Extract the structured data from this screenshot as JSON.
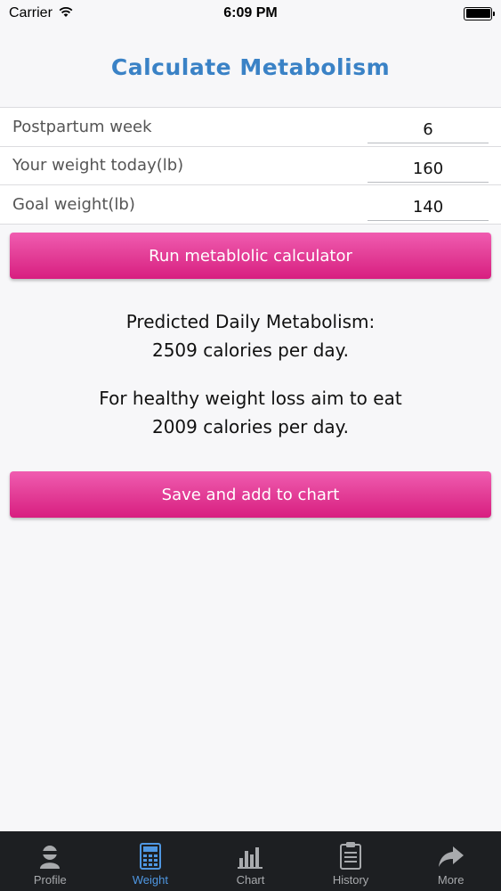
{
  "status_bar": {
    "carrier": "Carrier",
    "time": "6:09 PM",
    "icons": [
      "wifi-icon",
      "battery-icon"
    ]
  },
  "header": {
    "title": "Calculate Metabolism",
    "title_color": "#3a82c6"
  },
  "form": {
    "rows": [
      {
        "label": "Postpartum week",
        "value": "6"
      },
      {
        "label": "Your weight today(lb)",
        "value": "160"
      },
      {
        "label": "Goal weight(lb)",
        "value": "140"
      }
    ]
  },
  "actions": {
    "run_label": "Run metablolic calculator",
    "save_label": "Save and add to chart",
    "button_color": "#e33e97"
  },
  "results": {
    "metabolism_heading": "Predicted Daily Metabolism:",
    "metabolism_value": "2509 calories per day.",
    "loss_heading": "For healthy weight loss aim to eat",
    "loss_value": "2009 calories per day."
  },
  "tab_bar": {
    "active": "Weight",
    "active_color": "#4f97e2",
    "tabs": [
      {
        "label": "Profile",
        "icon": "profile-icon"
      },
      {
        "label": "Weight",
        "icon": "calculator-icon"
      },
      {
        "label": "Chart",
        "icon": "bar-chart-icon"
      },
      {
        "label": "History",
        "icon": "clipboard-icon"
      },
      {
        "label": "More",
        "icon": "share-arrow-icon"
      }
    ]
  }
}
